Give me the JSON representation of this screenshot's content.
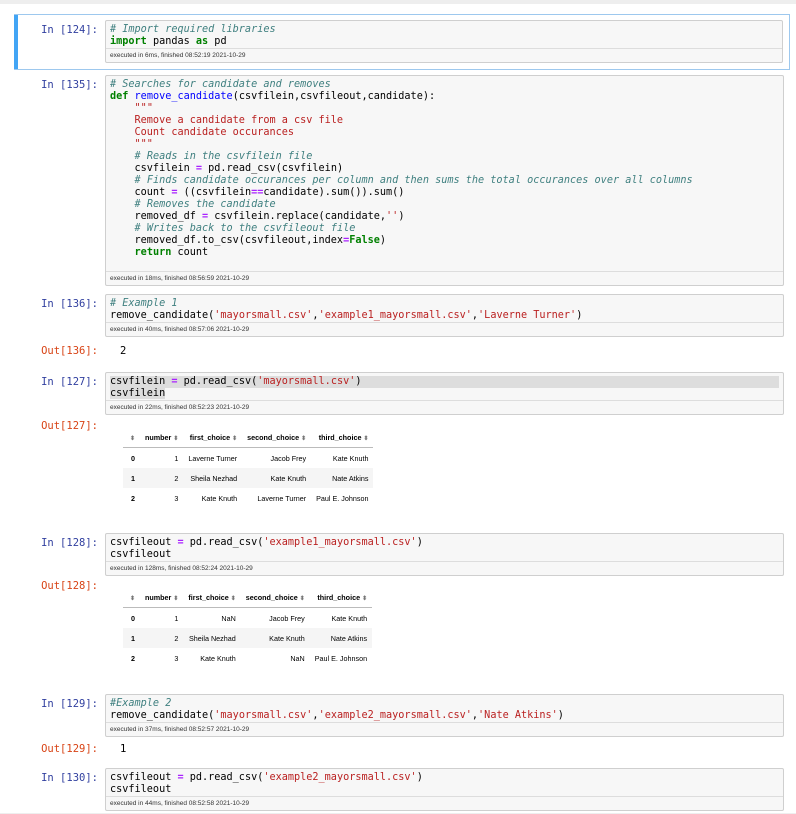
{
  "cells": [
    {
      "prompt": "In [124]:",
      "code": "<span class=\"cm\"># Import required libraries</span>\n<span class=\"kw\">import</span> pandas <span class=\"kw\">as</span> pd",
      "exec": "executed in 6ms, finished 08:52:19 2021-10-29"
    },
    {
      "prompt": "In [135]:",
      "code": "<span class=\"cm\"># Searches for candidate and removes</span>\n<span class=\"kw\">def</span> <span class=\"fn\">remove_candidate</span>(csvfilein,csvfileout,candidate):\n    <span class=\"str\">\"\"\"</span>\n<span class=\"str\">    Remove a candidate from a csv file</span>\n<span class=\"str\">    Count candidate occurances</span>\n<span class=\"str\">    \"\"\"</span>\n    <span class=\"cm\"># Reads in the csvfilein file</span>\n    csvfilein <span class=\"op\">=</span> pd.read_csv(csvfilein)\n    <span class=\"cm\"># Finds candidate occurances per column and then sums the total occurances over all columns</span>\n    count <span class=\"op\">=</span> ((csvfilein<span class=\"op\">==</span>candidate).sum()).sum()\n    <span class=\"cm\"># Removes the candidate</span>\n    removed_df <span class=\"op\">=</span> csvfilein.replace(candidate,<span class=\"str\">''</span>)\n    <span class=\"cm\"># Writes back to the csvfileout file</span>\n    removed_df.to_csv(csvfileout,index<span class=\"op\">=</span><span class=\"kw\">False</span>)\n    <span class=\"kw\">return</span> count\n ",
      "exec": "executed in 18ms, finished 08:56:59 2021-10-29"
    },
    {
      "prompt": "In [136]:",
      "code": "<span class=\"cm\"># Example 1</span>\nremove_candidate(<span class=\"str\">'mayorsmall.csv'</span>,<span class=\"str\">'example1_mayorsmall.csv'</span>,<span class=\"str\">'Laverne Turner'</span>)",
      "exec": "executed in 40ms, finished 08:57:06 2021-10-29",
      "out_prompt": "Out[136]:",
      "out_value": "2"
    },
    {
      "prompt": "In [127]:",
      "code": "<span class=\"hl\">csvfilein <span class=\"op\">=</span> pd.read_csv(<span class=\"str\">'mayorsmall.csv'</span>)</span>\n<span style=\"background:#dddddd\">csvfilein</span>",
      "exec": "executed in 22ms, finished 08:52:23 2021-10-29",
      "out_prompt": "Out[127]:"
    },
    {
      "prompt": "In [128]:",
      "code": "csvfileout <span class=\"op\">=</span> pd.read_csv(<span class=\"str\">'example1_mayorsmall.csv'</span>)\ncsvfileout",
      "exec": "executed in 128ms, finished 08:52:24 2021-10-29",
      "out_prompt": "Out[128]:"
    },
    {
      "prompt": "In [129]:",
      "code": "<span class=\"cm\">#Example 2</span>\nremove_candidate(<span class=\"str\">'mayorsmall.csv'</span>,<span class=\"str\">'example2_mayorsmall.csv'</span>,<span class=\"str\">'Nate Atkins'</span>)",
      "exec": "executed in 37ms, finished 08:52:57 2021-10-29",
      "out_prompt": "Out[129]:",
      "out_value": "1"
    },
    {
      "prompt": "In [130]:",
      "code": "csvfileout <span class=\"op\">=</span> pd.read_csv(<span class=\"str\">'example2_mayorsmall.csv'</span>)\ncsvfileout",
      "exec": "executed in 44ms, finished 08:52:58 2021-10-29"
    }
  ],
  "tables": {
    "t127": {
      "sort_glyph": "⬍",
      "headers": [
        "",
        "number",
        "first_choice",
        "second_choice",
        "third_choice"
      ],
      "rows": [
        [
          "0",
          "1",
          "Laverne Turner",
          "Jacob Frey",
          "Kate Knuth"
        ],
        [
          "1",
          "2",
          "Sheila Nezhad",
          "Kate Knuth",
          "Nate Atkins"
        ],
        [
          "2",
          "3",
          "Kate Knuth",
          "Laverne Turner",
          "Paul E. Johnson"
        ]
      ]
    },
    "t128": {
      "sort_glyph": "⬍",
      "headers": [
        "",
        "number",
        "first_choice",
        "second_choice",
        "third_choice"
      ],
      "rows": [
        [
          "0",
          "1",
          "NaN",
          "Jacob Frey",
          "Kate Knuth"
        ],
        [
          "1",
          "2",
          "Sheila Nezhad",
          "Kate Knuth",
          "Nate Atkins"
        ],
        [
          "2",
          "3",
          "Kate Knuth",
          "NaN",
          "Paul E. Johnson"
        ]
      ]
    }
  }
}
